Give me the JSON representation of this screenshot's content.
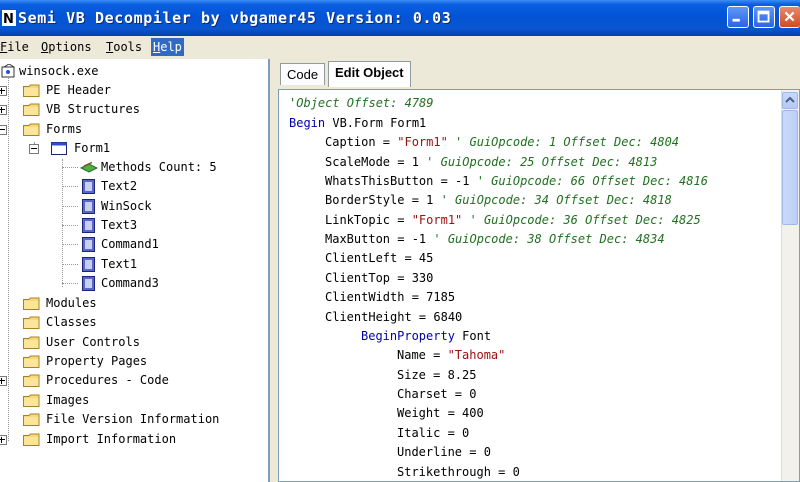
{
  "window": {
    "title": "Semi VB Decompiler by vbgamer45 Version: 0.03"
  },
  "menu": [
    {
      "hot": "F",
      "rest": "ile"
    },
    {
      "hot": "O",
      "rest": "ptions"
    },
    {
      "hot": "T",
      "rest": "ools"
    },
    {
      "hot": "H",
      "rest": "elp"
    }
  ],
  "tree": {
    "root": "winsock.exe",
    "items": [
      {
        "label": "PE Header",
        "expander": "+"
      },
      {
        "label": "VB Structures",
        "expander": "+"
      },
      {
        "label": "Forms",
        "expander": "-"
      },
      {
        "label": "Form1",
        "expander": "-"
      },
      {
        "label": "Methods Count: 5"
      },
      {
        "label": "Text2"
      },
      {
        "label": "WinSock"
      },
      {
        "label": "Text3"
      },
      {
        "label": "Command1"
      },
      {
        "label": "Text1"
      },
      {
        "label": "Command3"
      },
      {
        "label": "Modules"
      },
      {
        "label": "Classes"
      },
      {
        "label": "User Controls"
      },
      {
        "label": "Property Pages"
      },
      {
        "label": "Procedures - Code",
        "expander": "+"
      },
      {
        "label": "Images"
      },
      {
        "label": "File Version Information"
      },
      {
        "label": "Import Information",
        "expander": "+"
      }
    ]
  },
  "tabs": [
    "Code",
    "Edit Object"
  ],
  "code": {
    "l0": "'Object Offset: 4789",
    "l1_kw": "Begin",
    "l1_rest": " VB.Form Form1",
    "l2_a": "Caption = ",
    "l2_s": "\"Form1\"",
    "l2_c": "  ' GuiOpcode: 1 Offset Dec: 4804",
    "l3_a": "ScaleMode = 1",
    "l3_c": "  ' GuiOpcode: 25 Offset Dec: 4813",
    "l4_a": "WhatsThisButton = -1",
    "l4_c": "  ' GuiOpcode: 66 Offset Dec: 4816",
    "l5_a": "BorderStyle = 1",
    "l5_c": "  ' GuiOpcode: 34 Offset Dec: 4818",
    "l6_a": "LinkTopic = ",
    "l6_s": "\"Form1\"",
    "l6_c": "  ' GuiOpcode: 36 Offset Dec: 4825",
    "l7_a": "MaxButton = -1",
    "l7_c": "  ' GuiOpcode: 38 Offset Dec: 4834",
    "l8": "ClientLeft = 45",
    "l9": "ClientTop = 330",
    "l10": "ClientWidth = 7185",
    "l11": "ClientHeight = 6840",
    "l12_kw": "BeginProperty",
    "l12_rest": " Font",
    "l13_a": "Name = ",
    "l13_s": "\"Tahoma\"",
    "l14": "Size = 8.25",
    "l15": "Charset = 0",
    "l16": "Weight = 400",
    "l17": "Italic = 0",
    "l18": "Underline = 0",
    "l19": "Strikethrough = 0"
  }
}
